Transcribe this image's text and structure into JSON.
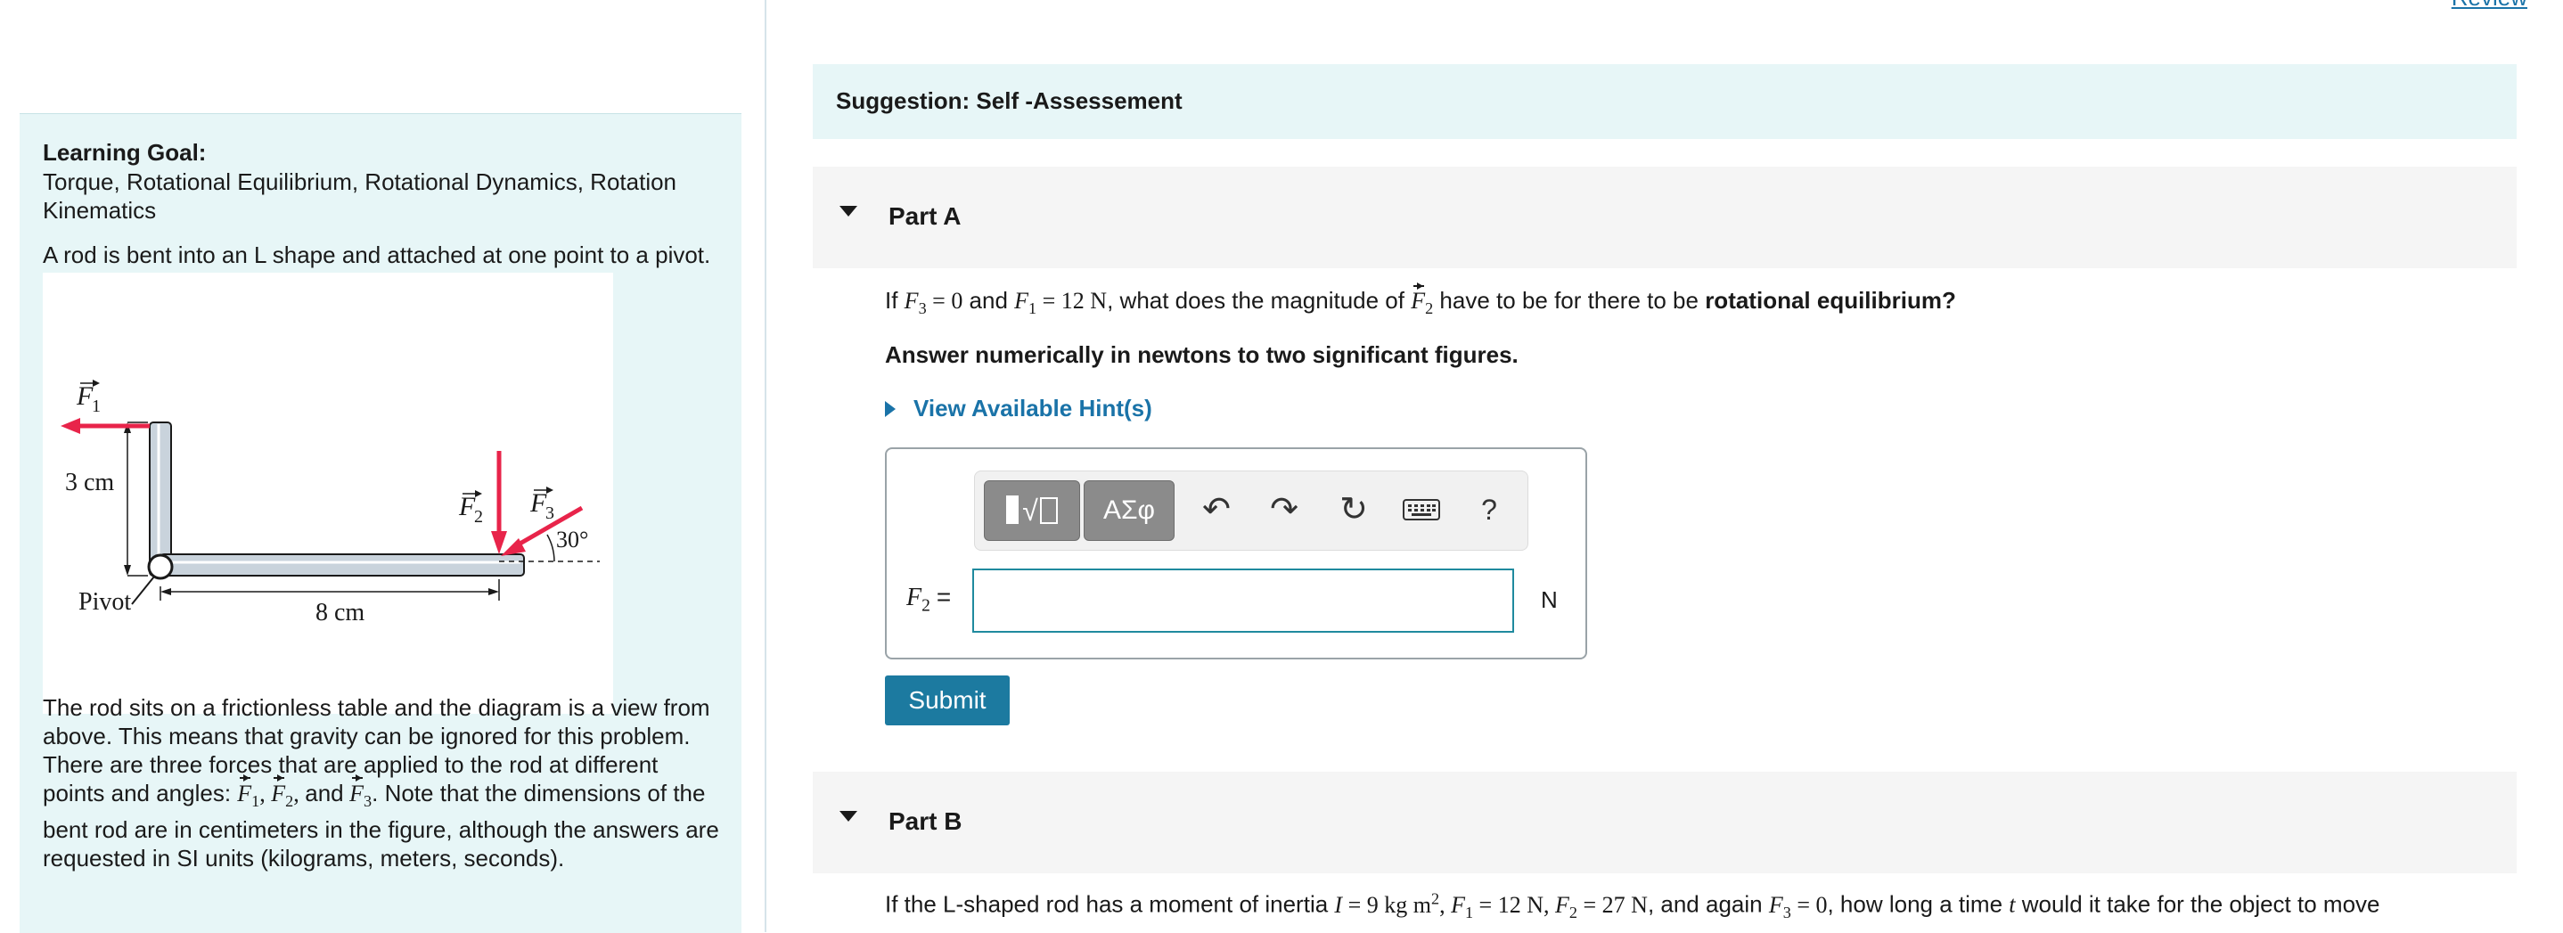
{
  "learning_goal": {
    "heading": "Learning Goal:",
    "topics": "Torque, Rotational Equilibrium, Rotational Dynamics, Rotation Kinematics",
    "intro": "A rod is bent into an L shape and attached at one point to a pivot.",
    "description_1": "The rod sits on a frictionless table and the diagram is a view from above. This means that gravity can be ignored for this problem. There are three forces that are applied to the rod at different points and angles: ",
    "description_2": ". Note that the dimensions of the bent rod are in centimeters in the figure, although the answers are requested in SI units (kilograms, meters, seconds)."
  },
  "figure": {
    "height_label": "3 cm",
    "length_label": "8 cm",
    "pivot_label": "Pivot",
    "angle_label": "30°",
    "force_labels": [
      "F1",
      "F2",
      "F3"
    ],
    "colors": {
      "force": "#e8244a",
      "rod": "#c9d3dc",
      "rod_edge": "#1a1a1a"
    }
  },
  "header": {
    "review_link": "Review"
  },
  "suggestion": "Suggestion: Self -Assessement",
  "part_a": {
    "label": "Part A",
    "question_prefix": "If ",
    "question_mid1": " and ",
    "question_mid2": ", what does the magnitude of ",
    "question_mid3": " have to be for there to be ",
    "question_bold": "rotational equilibrium?",
    "instruction": "Answer numerically in newtons to two significant figures.",
    "hint_link": "View Available Hint(s)",
    "answer_label": "F2 =",
    "unit": "N",
    "input_value": "",
    "submit_label": "Submit",
    "toolbar": {
      "templates": "√",
      "symbols": "ΑΣφ",
      "help": "?"
    }
  },
  "part_b": {
    "label": "Part B",
    "question_prefix": "If the L-shaped rod has a moment of inertia ",
    "question_mid": ", and again ",
    "question_suffix": ", how long a time ",
    "question_end": " would it take for the object to move"
  },
  "colors": {
    "accent": "#1a73a8",
    "panel": "#e7f6f7",
    "submit": "#1c7aa0"
  }
}
